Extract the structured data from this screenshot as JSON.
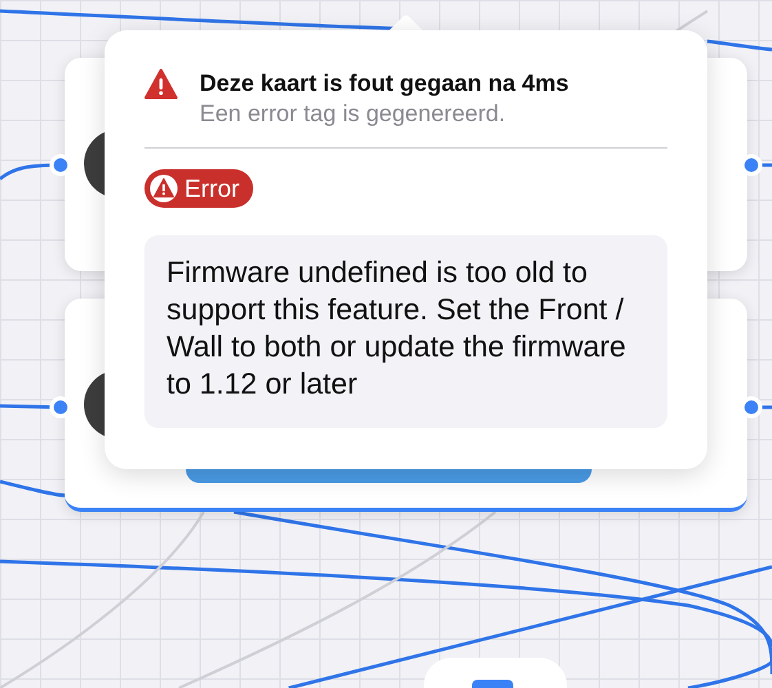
{
  "popover": {
    "title": "Deze kaart is fout gegaan na 4ms",
    "subtitle": "Een error tag is gegenereerd.",
    "tag": {
      "label": "Error",
      "kind": "error"
    },
    "message": "Firmware undefined is too old to support this feature. Set the Front / Wall to both or update the firmware to 1.12 or later"
  }
}
